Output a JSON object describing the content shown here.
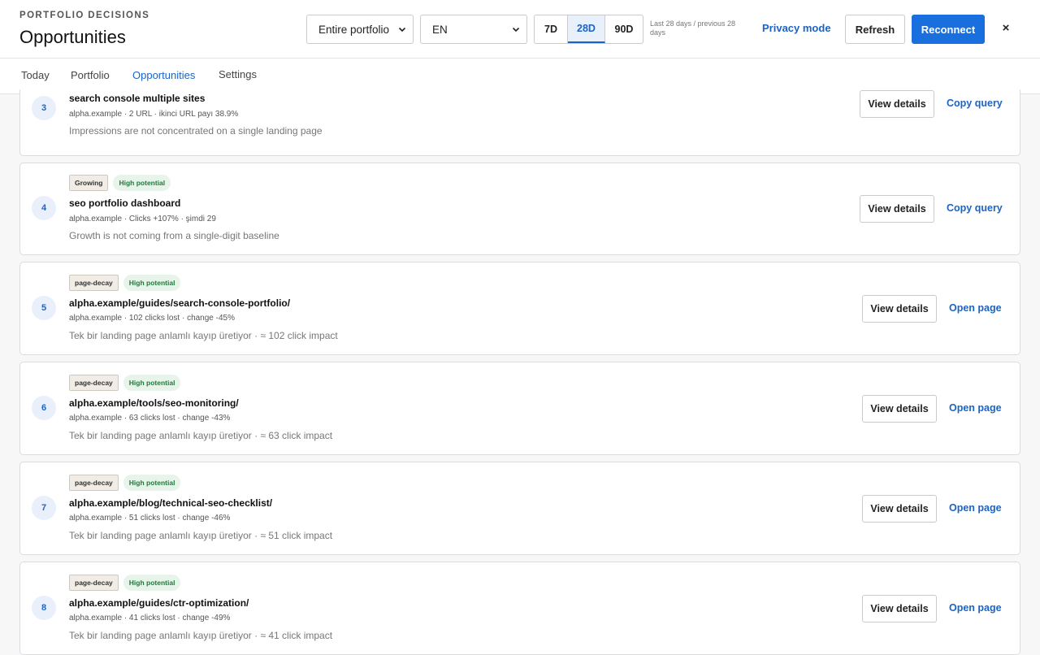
{
  "header": {
    "eyebrow": "PORTFOLIO DECISIONS",
    "title": "Opportunities",
    "scope_select": "Entire portfolio",
    "lang_select": "EN",
    "ranges": [
      "7D",
      "28D",
      "90D"
    ],
    "active_range": "28D",
    "range_note": "Last 28 days / previous 28 days",
    "privacy_label": "Privacy mode",
    "refresh_label": "Refresh",
    "reconnect_label": "Reconnect",
    "close_label": "×"
  },
  "tabs": [
    {
      "label": "Today"
    },
    {
      "label": "Portfolio"
    },
    {
      "label": "Opportunities",
      "active": true
    },
    {
      "label": "Settings"
    }
  ],
  "cards": [
    {
      "rank": "3",
      "tags": [],
      "title": "search console multiple sites",
      "meta": "alpha.example · 2 URL · ikinci URL payı 38.9%",
      "desc": "Impressions are not concentrated on a single landing page",
      "view_label": "View details",
      "action_label": "Copy query"
    },
    {
      "rank": "4",
      "tags": [
        "Growing",
        "High potential"
      ],
      "title": "seo portfolio dashboard",
      "meta": "alpha.example · Clicks +107% · şimdi 29",
      "desc": "Growth is not coming from a single-digit baseline",
      "view_label": "View details",
      "action_label": "Copy query"
    },
    {
      "rank": "5",
      "tags": [
        "page-decay",
        "High potential"
      ],
      "title": "alpha.example/guides/search-console-portfolio/",
      "meta": "alpha.example · 102 clicks lost · change -45%",
      "desc": "Tek bir landing page anlamlı kayıp üretiyor · ≈ 102 click impact",
      "view_label": "View details",
      "action_label": "Open page"
    },
    {
      "rank": "6",
      "tags": [
        "page-decay",
        "High potential"
      ],
      "title": "alpha.example/tools/seo-monitoring/",
      "meta": "alpha.example · 63 clicks lost · change -43%",
      "desc": "Tek bir landing page anlamlı kayıp üretiyor · ≈ 63 click impact",
      "view_label": "View details",
      "action_label": "Open page"
    },
    {
      "rank": "7",
      "tags": [
        "page-decay",
        "High potential"
      ],
      "title": "alpha.example/blog/technical-seo-checklist/",
      "meta": "alpha.example · 51 clicks lost · change -46%",
      "desc": "Tek bir landing page anlamlı kayıp üretiyor · ≈ 51 click impact",
      "view_label": "View details",
      "action_label": "Open page"
    },
    {
      "rank": "8",
      "tags": [
        "page-decay",
        "High potential"
      ],
      "title": "alpha.example/guides/ctr-optimization/",
      "meta": "alpha.example · 41 clicks lost · change -49%",
      "desc": "Tek bir landing page anlamlı kayıp üretiyor · ≈ 41 click impact",
      "view_label": "View details",
      "action_label": "Open page"
    }
  ]
}
